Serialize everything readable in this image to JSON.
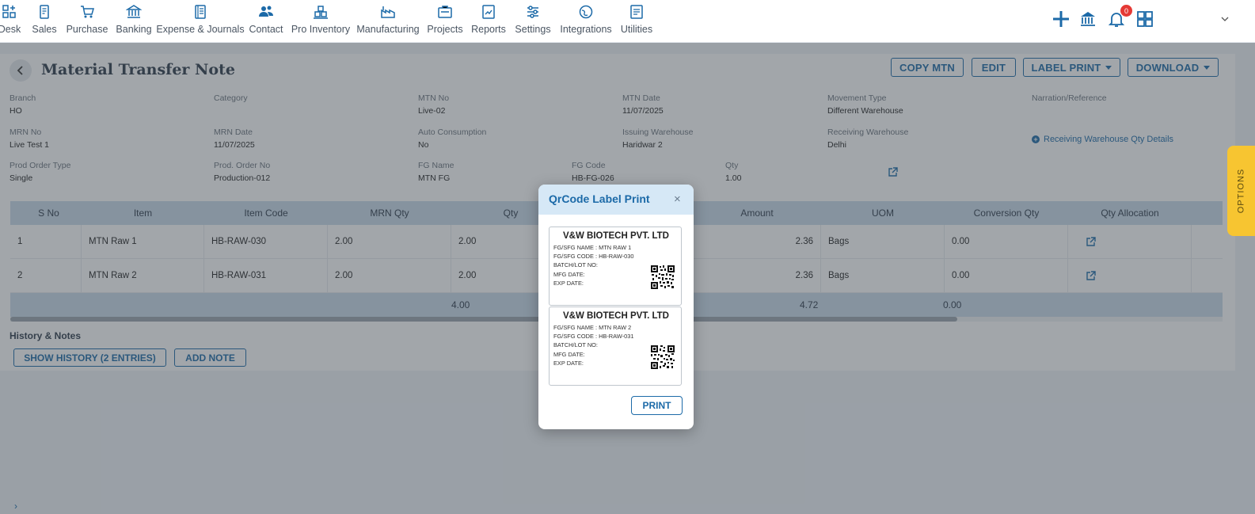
{
  "nav": {
    "items": [
      {
        "label": "Desk",
        "icon": "desk-icon"
      },
      {
        "label": "Sales",
        "icon": "sales-icon"
      },
      {
        "label": "Purchase",
        "icon": "cart-icon"
      },
      {
        "label": "Banking",
        "icon": "bank-icon"
      },
      {
        "label": "Expense & Journals",
        "icon": "journal-icon"
      },
      {
        "label": "Contact",
        "icon": "contacts-icon"
      },
      {
        "label": "Pro Inventory",
        "icon": "inventory-icon"
      },
      {
        "label": "Manufacturing",
        "icon": "factory-icon"
      },
      {
        "label": "Projects",
        "icon": "projects-icon"
      },
      {
        "label": "Reports",
        "icon": "reports-icon"
      },
      {
        "label": "Settings",
        "icon": "sliders-icon"
      },
      {
        "label": "Integrations",
        "icon": "globe-icon"
      },
      {
        "label": "Utilities",
        "icon": "utilities-icon"
      }
    ],
    "notification_count": "0"
  },
  "page": {
    "title": "Material Transfer Note",
    "buttons": {
      "copy": "COPY MTN",
      "edit": "EDIT",
      "label_print": "LABEL PRINT",
      "download": "DOWNLOAD"
    },
    "fields": [
      {
        "key": "Branch",
        "value": "HO"
      },
      {
        "key": "Category",
        "value": ""
      },
      {
        "key": "MTN No",
        "value": "Live-02"
      },
      {
        "key": "MTN Date",
        "value": "11/07/2025"
      },
      {
        "key": "Movement Type",
        "value": "Different Warehouse"
      },
      {
        "key": "Narration/Reference",
        "value": ""
      },
      {
        "key": "MRN No",
        "value": "Live Test 1"
      },
      {
        "key": "MRN Date",
        "value": "11/07/2025"
      },
      {
        "key": "Auto Consumption",
        "value": "No"
      },
      {
        "key": "Issuing Warehouse",
        "value": "Haridwar 2"
      },
      {
        "key": "Receiving Warehouse",
        "value": "Delhi"
      },
      {
        "key": "Prod Order Type",
        "value": "Single"
      },
      {
        "key": "Prod. Order No",
        "value": "Production-012"
      },
      {
        "key": "FG Name",
        "value": "MTN FG"
      },
      {
        "key": "FG Code",
        "value": "HB-FG-026"
      },
      {
        "key": "Qty",
        "value": "1.00"
      }
    ],
    "receiving_link": "Receiving Warehouse Qty Details",
    "table": {
      "headers": [
        "S No",
        "Item",
        "Item Code",
        "MRN Qty",
        "Qty",
        "Amount",
        "UOM",
        "Conversion Qty",
        "Qty Allocation"
      ],
      "rows": [
        {
          "sno": "1",
          "item": "MTN Raw 1",
          "code": "HB-RAW-030",
          "mrn_qty": "2.00",
          "qty": "2.00",
          "amount": "2.36",
          "uom": "Bags",
          "conv": "0.00"
        },
        {
          "sno": "2",
          "item": "MTN Raw 2",
          "code": "HB-RAW-031",
          "mrn_qty": "2.00",
          "qty": "2.00",
          "amount": "2.36",
          "uom": "Bags",
          "conv": "0.00"
        }
      ],
      "totals": {
        "qty": "4.00",
        "amount": "4.72",
        "conv": "0.00"
      }
    },
    "history": {
      "title": "History & Notes",
      "show_history": "SHOW HISTORY (2 ENTRIES)",
      "add_note": "ADD NOTE"
    }
  },
  "options_tab": "OPTIONS",
  "modal": {
    "title": "QrCode Label Print",
    "close": "×",
    "labels": [
      {
        "company": "V&W BIOTECH PVT. LTD",
        "name_line": "FG/SFG NAME : MTN RAW 1",
        "code_line": "FG/SFG CODE : HB-RAW-030",
        "batch_line": "BATCH/LOT NO:",
        "mfg_line": "MFG DATE:",
        "exp_line": "EXP DATE:"
      },
      {
        "company": "V&W BIOTECH PVT. LTD",
        "name_line": "FG/SFG NAME : MTN RAW 2",
        "code_line": "FG/SFG CODE : HB-RAW-031",
        "batch_line": "BATCH/LOT NO:",
        "mfg_line": "MFG DATE:",
        "exp_line": "EXP DATE:"
      }
    ],
    "print": "PRINT"
  },
  "colors": {
    "primary": "#1c6aa8",
    "header_band": "#c9daea",
    "options_tab": "#f7c531",
    "badge": "#e53935"
  }
}
